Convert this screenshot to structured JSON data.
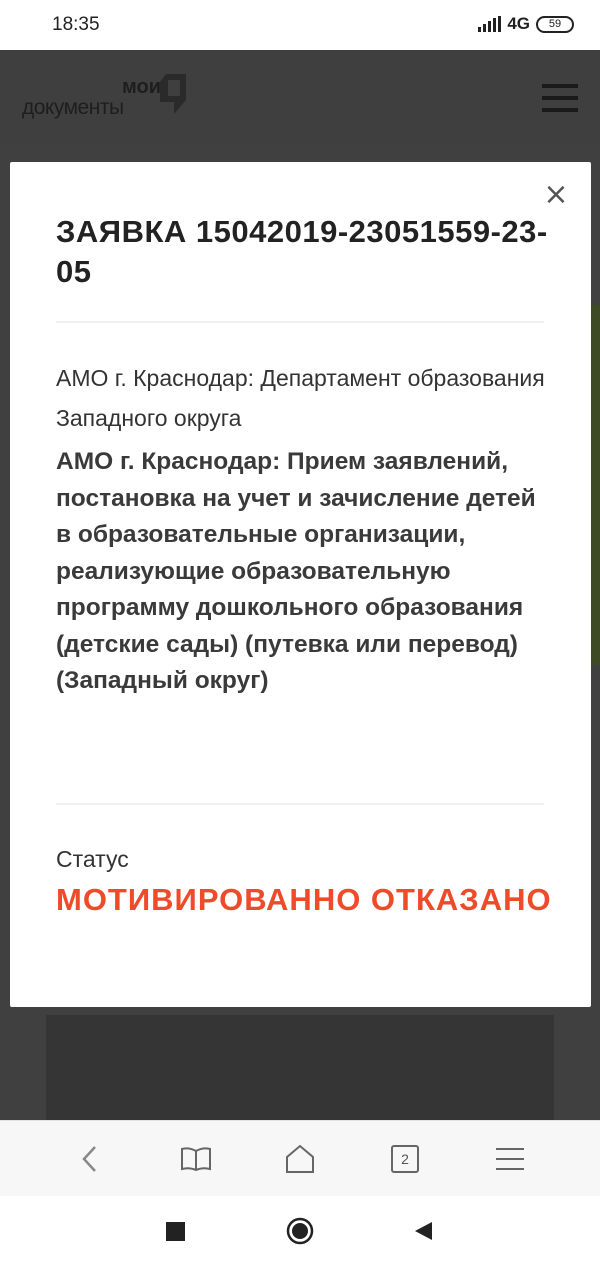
{
  "status_bar": {
    "time": "18:35",
    "network": "4G",
    "battery": "59"
  },
  "header": {
    "logo_top": "мои",
    "logo_bottom": "документы"
  },
  "modal": {
    "title": "ЗАЯВКА 15042019-23051559-23-05",
    "department": "АМО г. Краснодар: Департамент образования Западного округа",
    "service": "АМО г. Краснодар: Прием заявлений, постановка на учет и зачисление детей в образовательные организации, реализующие образовательную программу дошкольного образования (детские сады) (путевка или перевод) (Западный округ)",
    "status_label": "Статус",
    "status_value": "МОТИВИРОВАННО ОТКАЗАНО",
    "close_icon": "close-icon"
  },
  "browser_bar": {
    "tabs_count": "2",
    "icons": [
      "back-icon",
      "bookmarks-icon",
      "home-icon",
      "tabs-icon",
      "menu-icon"
    ]
  },
  "nav_bar": {
    "icons": [
      "recent-apps-icon",
      "home-icon",
      "back-icon"
    ]
  },
  "colors": {
    "status_red": "#ee4b2b",
    "header_bg": "#3f3f3f",
    "overlay_bg": "#404040"
  }
}
